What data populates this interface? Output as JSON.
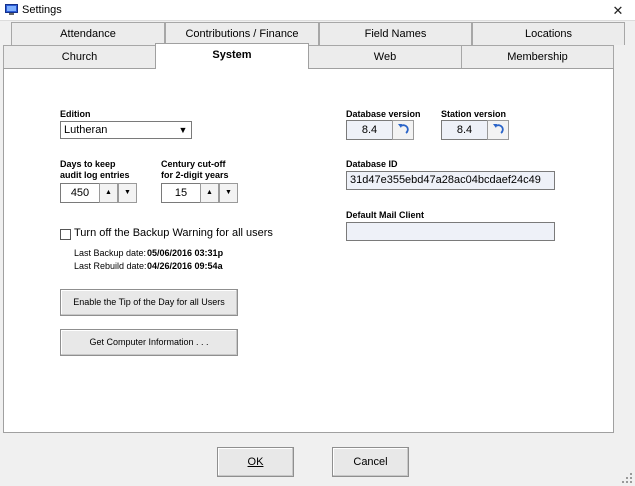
{
  "window": {
    "title": "Settings",
    "close_glyph": "✕"
  },
  "tabs_top": [
    "Attendance",
    "Contributions / Finance",
    "Field Names",
    "Locations"
  ],
  "tabs_bottom": [
    "Church",
    "System",
    "Web",
    "Membership"
  ],
  "active_tab": "System",
  "edition": {
    "label": "Edition",
    "value": "Lutheran"
  },
  "audit_log": {
    "label_line1": "Days to keep",
    "label_line2": "audit log entries",
    "value": "450"
  },
  "century": {
    "label_line1": "Century cut-off",
    "label_line2": "for 2-digit years",
    "value": "15"
  },
  "backup_warning": {
    "label": "Turn off the Backup Warning for all users",
    "checked": false
  },
  "last_backup": {
    "label": "Last Backup date:",
    "value": "05/06/2016 03:31p"
  },
  "last_rebuild": {
    "label": "Last Rebuild date:",
    "value": "04/26/2016 09:54a"
  },
  "buttons": {
    "tip_of_day": "Enable the Tip of the Day for all Users",
    "computer_info": "Get Computer Information . . .",
    "ok": "OK",
    "cancel": "Cancel"
  },
  "database_version": {
    "label": "Database version",
    "value": "8.4"
  },
  "station_version": {
    "label": "Station version",
    "value": "8.4"
  },
  "database_id": {
    "label": "Database ID",
    "value": "31d47e355ebd47a28ac04bcdaef24c49"
  },
  "mail_client": {
    "label": "Default Mail Client",
    "value": ""
  },
  "icons": {
    "app": "settings-app-icon",
    "spin_up": "▲",
    "spin_down": "▼",
    "combo_arrow": "▼"
  },
  "colors": {
    "field_bg": "#eef1f8",
    "undo_icon": "#2a64c8"
  }
}
